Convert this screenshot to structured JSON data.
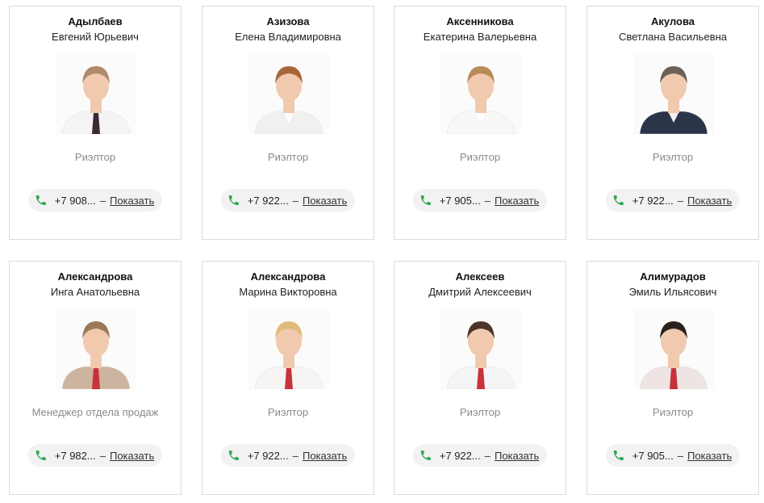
{
  "cards": [
    {
      "surname": "Адылбаев",
      "given": "Евгений Юрьевич",
      "role": "Риэлтор",
      "phone": "+7 908...",
      "show": "Показать",
      "hair": "#b08a6c",
      "shirt": "#f5f3f3",
      "tie": "#3a2a33",
      "dark": false
    },
    {
      "surname": "Азизова",
      "given": "Елена Владимировна",
      "role": "Риэлтор",
      "phone": "+7 922...",
      "show": "Показать",
      "hair": "#a8653a",
      "shirt": "#f0f0f0",
      "tie": "",
      "dark": false
    },
    {
      "surname": "Аксенникова",
      "given": "Екатерина Валерьевна",
      "role": "Риэлтор",
      "phone": "+7 905...",
      "show": "Показать",
      "hair": "#b88a55",
      "shirt": "#f7f7f7",
      "tie": "",
      "dark": false
    },
    {
      "surname": "Акулова",
      "given": "Светлана Васильевна",
      "role": "Риэлтор",
      "phone": "+7 922...",
      "show": "Показать",
      "hair": "#6b6158",
      "shirt": "#2b3448",
      "tie": "",
      "dark": true
    },
    {
      "surname": "Александрова",
      "given": "Инга Анатольевна",
      "role": "Менеджер отдела продаж",
      "phone": "+7 982...",
      "show": "Показать",
      "hair": "#9a7a58",
      "shirt": "#cdb49e",
      "tie": "#c8323a",
      "dark": false
    },
    {
      "surname": "Александрова",
      "given": "Марина Викторовна",
      "role": "Риэлтор",
      "phone": "+7 922...",
      "show": "Показать",
      "hair": "#e0bc7a",
      "shirt": "#f7f4f4",
      "tie": "#c8323a",
      "dark": false
    },
    {
      "surname": "Алексеев",
      "given": "Дмитрий Алексеевич",
      "role": "Риэлтор",
      "phone": "+7 922...",
      "show": "Показать",
      "hair": "#4a3528",
      "shirt": "#f5f5f7",
      "tie": "#c8323a",
      "dark": false
    },
    {
      "surname": "Алимурадов",
      "given": "Эмиль Ильясович",
      "role": "Риэлтор",
      "phone": "+7 905...",
      "show": "Показать",
      "hair": "#2a211c",
      "shirt": "#efe4e4",
      "tie": "#c8323a",
      "dark": false
    }
  ],
  "icons": {
    "phone": "phone-icon",
    "photo": "agent-photo"
  },
  "colors": {
    "phone_green": "#2fa84f",
    "role_gray": "#8a8a8a",
    "pill_bg": "#f2f2f2"
  },
  "separator": "–"
}
